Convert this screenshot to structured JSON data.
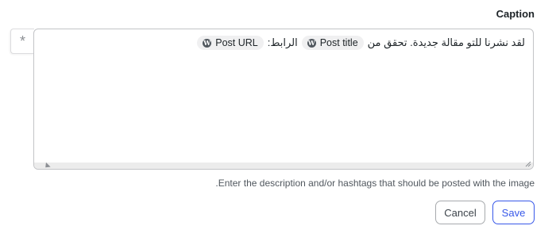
{
  "field": {
    "label": "Caption",
    "asterisk": "*",
    "text_before": "لقد نشرنا للتو مقالة جديدة. تحقق من",
    "text_middle": "الرابط:",
    "token_post_title": "Post title",
    "token_post_url": "Post URL",
    "token_icon": "wordpress-icon",
    "help": "Enter the description and/or hashtags that should be posted with the image."
  },
  "actions": {
    "cancel_label": "Cancel",
    "save_label": "Save"
  },
  "colors": {
    "accent": "#3858e9",
    "border": "#c3c4c7",
    "token_bg": "#f0f0f1"
  }
}
